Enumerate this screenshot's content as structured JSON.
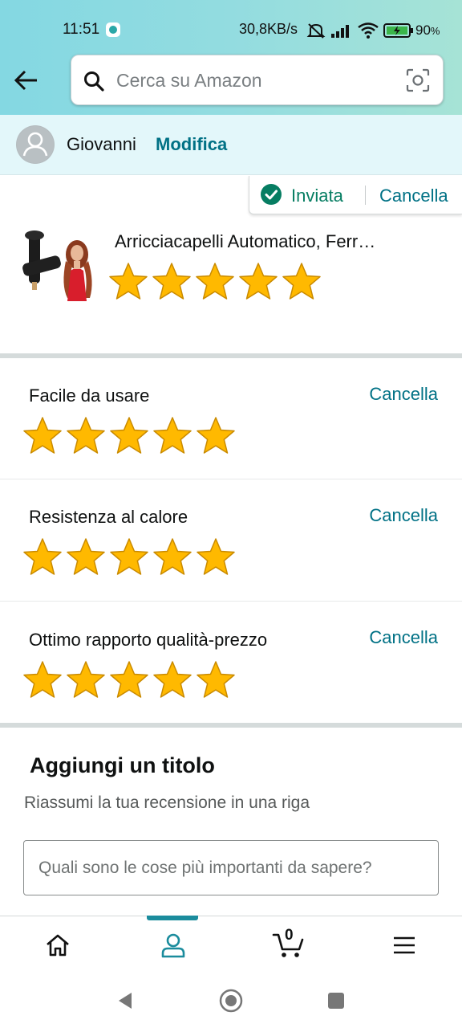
{
  "status_bar": {
    "time": "11:51",
    "network_speed": "30,8KB/s",
    "battery_percent": "90",
    "battery_suffix": "%"
  },
  "search": {
    "placeholder": "Cerca su Amazon"
  },
  "profile": {
    "name": "Giovanni",
    "edit_label": "Modifica"
  },
  "submission": {
    "status_label": "Inviata",
    "cancel_label": "Cancella"
  },
  "product": {
    "title": "Arricciacapelli Automatico, Ferr…",
    "rating": 5,
    "max_rating": 5
  },
  "attribute_ratings": [
    {
      "label": "Facile da usare",
      "cancel_label": "Cancella",
      "rating": 5
    },
    {
      "label": "Resistenza al calore",
      "cancel_label": "Cancella",
      "rating": 5
    },
    {
      "label": "Ottimo rapporto qualità-prezzo",
      "cancel_label": "Cancella",
      "rating": 5
    }
  ],
  "review_title": {
    "heading": "Aggiungi un titolo",
    "subtitle": "Riassumi la tua recensione in una riga",
    "input_placeholder": "Quali sono le cose più importanti da sapere?",
    "input_value": ""
  },
  "bottom_nav": {
    "items": [
      "home-icon",
      "account-icon",
      "cart-icon",
      "menu-icon"
    ],
    "active_index": 1,
    "cart_count": "0"
  },
  "colors": {
    "accent_teal": "#007185",
    "success_green": "#067d62",
    "star_gold": "#FFB900",
    "nav_indicator": "#1b8c9d"
  }
}
